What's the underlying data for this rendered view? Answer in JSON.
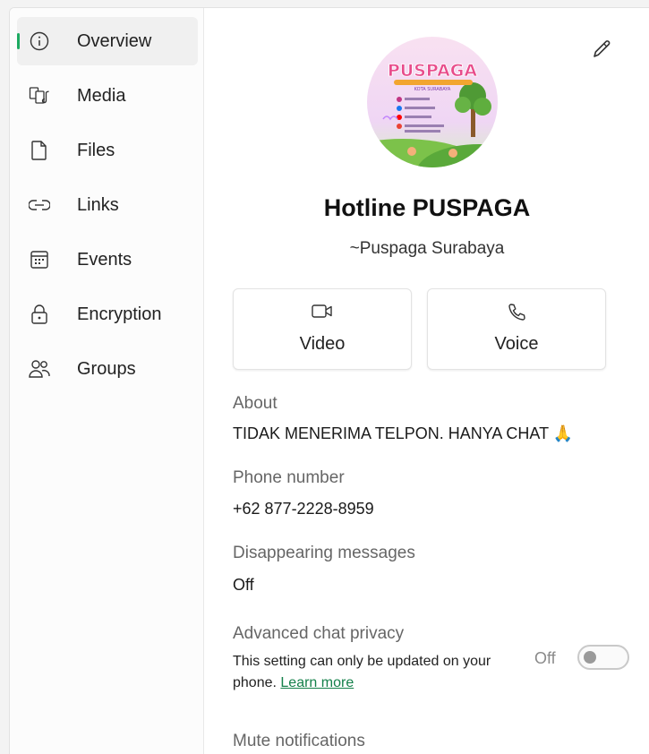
{
  "sidebar": {
    "items": [
      {
        "label": "Overview",
        "icon": "info-icon",
        "active": true
      },
      {
        "label": "Media",
        "icon": "media-icon"
      },
      {
        "label": "Files",
        "icon": "file-icon"
      },
      {
        "label": "Links",
        "icon": "link-icon"
      },
      {
        "label": "Events",
        "icon": "calendar-icon"
      },
      {
        "label": "Encryption",
        "icon": "lock-icon"
      },
      {
        "label": "Groups",
        "icon": "groups-icon"
      }
    ]
  },
  "profile": {
    "name": "Hotline PUSPAGA",
    "subtitle": "~Puspaga Surabaya",
    "avatar": {
      "logo_text": "PUSPAGA",
      "tagline": "KOTA SURABAYA"
    }
  },
  "actions": {
    "video_label": "Video",
    "voice_label": "Voice"
  },
  "about": {
    "label": "About",
    "value": "TIDAK MENERIMA TELPON. HANYA CHAT 🙏"
  },
  "phone": {
    "label": "Phone number",
    "value": "+62 877-2228-8959"
  },
  "disappearing": {
    "label": "Disappearing messages",
    "value": "Off"
  },
  "privacy": {
    "label": "Advanced chat privacy",
    "note": "This setting can only be updated on your phone.",
    "link": "Learn more",
    "toggle_label": "Off",
    "toggle_on": false
  },
  "mute": {
    "label": "Mute notifications"
  },
  "colors": {
    "accent": "#1daa61",
    "link": "#14804a"
  }
}
